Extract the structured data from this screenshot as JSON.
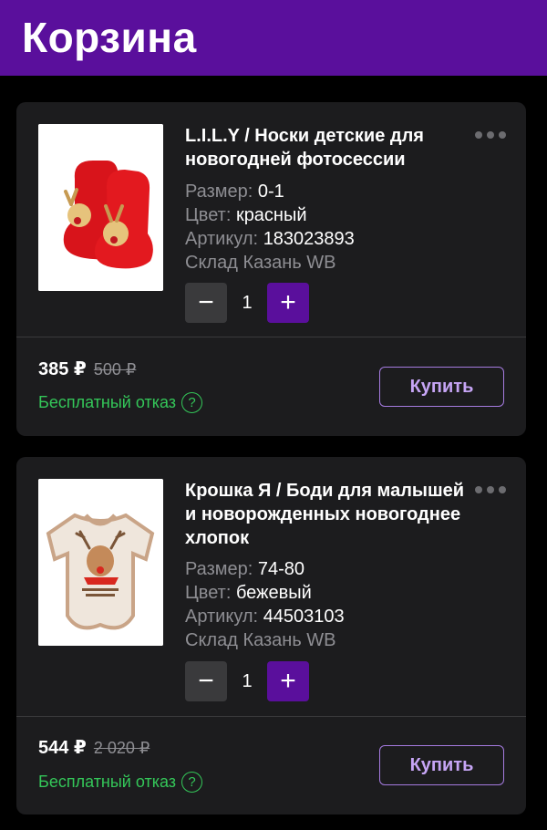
{
  "header": {
    "title": "Корзина"
  },
  "items": [
    {
      "title": "L.I.L.Y / Носки детские для новогодней фотосессии",
      "attributes": [
        {
          "key": "Размер:",
          "value": "0-1"
        },
        {
          "key": "Цвет:",
          "value": "красный"
        },
        {
          "key": "Артикул:",
          "value": "183023893"
        }
      ],
      "warehouse": "Склад Казань WB",
      "quantity": "1",
      "minus": "−",
      "plus": "+",
      "price": "385 ₽",
      "old_price": "500 ₽",
      "refund": "Бесплатный отказ",
      "refund_icon": "?",
      "buy_label": "Купить",
      "image_icon": "baby-socks-reindeer-image"
    },
    {
      "title": "Крошка Я / Боди для малышей и новорожденных новогоднее хлопок",
      "attributes": [
        {
          "key": "Размер:",
          "value": "74-80"
        },
        {
          "key": "Цвет:",
          "value": "бежевый"
        },
        {
          "key": "Артикул:",
          "value": "44503103"
        }
      ],
      "warehouse": "Склад Казань WB",
      "quantity": "1",
      "minus": "−",
      "plus": "+",
      "price": "544 ₽",
      "old_price": "2 020 ₽",
      "refund": "Бесплатный отказ",
      "refund_icon": "?",
      "buy_label": "Купить",
      "image_icon": "baby-bodysuit-reindeer-image"
    }
  ],
  "colors": {
    "header_bg": "#5a0f9c",
    "accent": "#5a0f9c",
    "refund_green": "#34c759",
    "buy_border": "#a57be0",
    "card_bg": "#1c1c1e"
  }
}
